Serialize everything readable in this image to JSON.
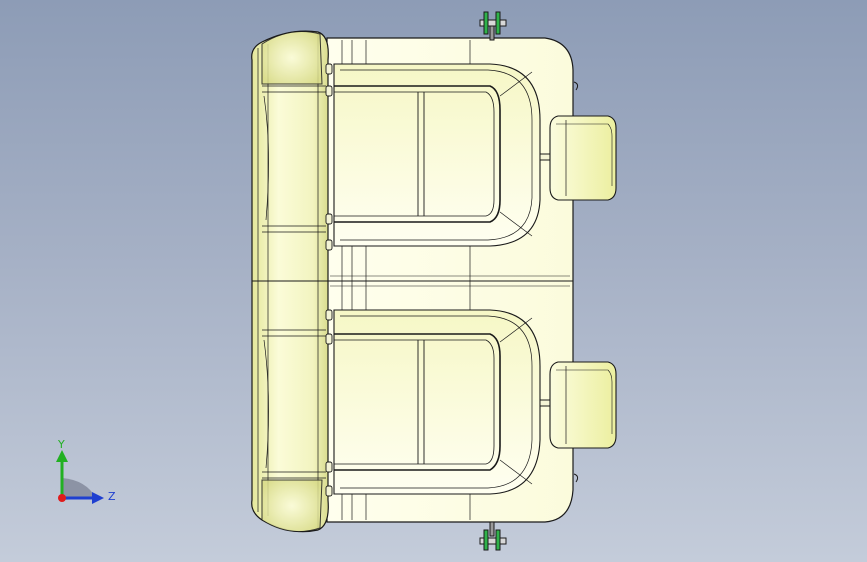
{
  "viewport": {
    "background_top": "#8d9cb6",
    "background_bottom": "#c4ccda",
    "model_fill": "#fdfde4",
    "model_shade": "#e9ec9e",
    "edge_color": "#1a1a1a"
  },
  "triad": {
    "y_label": "Y",
    "z_label": "Z",
    "y_color": "#22b022",
    "z_color": "#1e3fd0",
    "x_color": "#e01b1b"
  }
}
